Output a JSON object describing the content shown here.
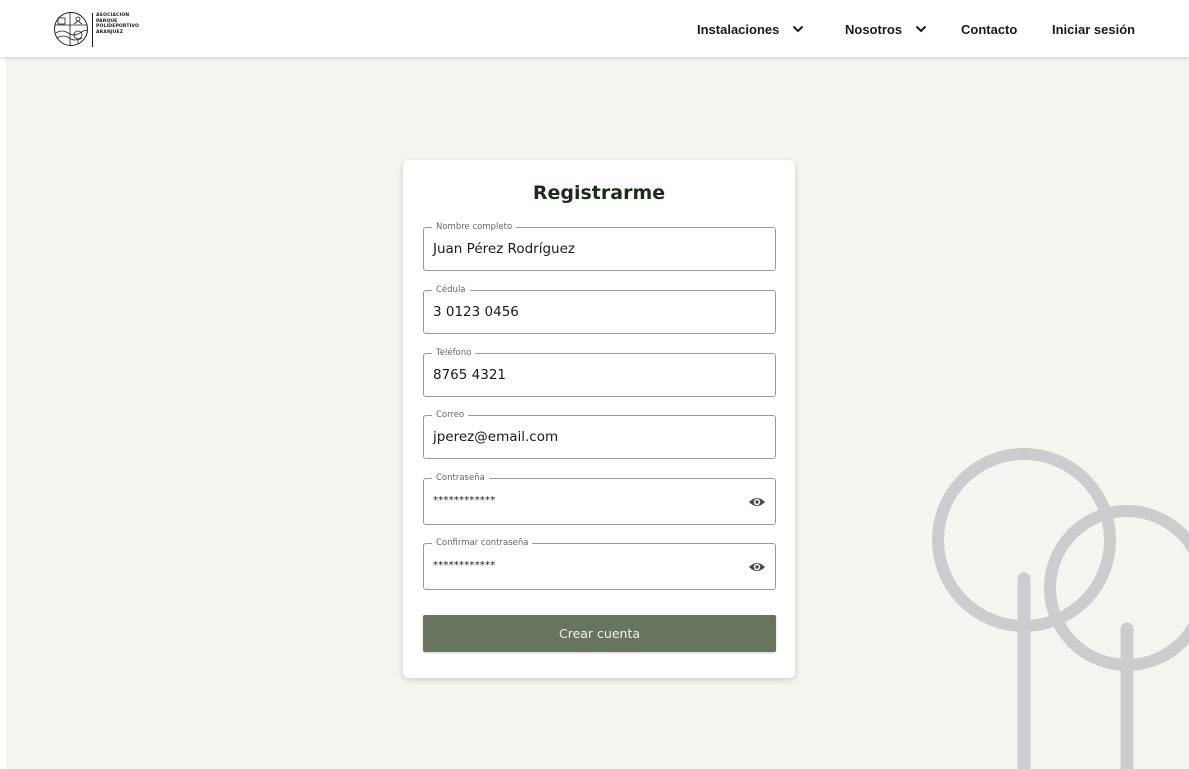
{
  "navbar": {
    "logo": {
      "lines": [
        "ASOCIACION",
        "PARQUE",
        "POLIDEPORTIVO",
        "ARANJUEZ"
      ],
      "icon": "park-emblem-icon"
    },
    "items": [
      {
        "label": "Instalaciones",
        "icon": "chevron-down-icon"
      },
      {
        "label": "Nosotros",
        "icon": "chevron-down-icon"
      },
      {
        "label": "Contacto"
      },
      {
        "label": "Iniciar sesión"
      }
    ]
  },
  "form": {
    "title": "Registrarme",
    "fields": [
      {
        "label": "Nombre completo",
        "value": "Juan Pérez Rodríguez"
      },
      {
        "label": "Cédula",
        "value": "3 0123 0456"
      },
      {
        "label": "Teléfono",
        "value": "8765 4321"
      },
      {
        "label": "Correo",
        "value": "jperez@email.com"
      },
      {
        "label": "Contraseña",
        "value": "************",
        "icon": "eye-icon"
      },
      {
        "label": "Confirmar contraseña",
        "value": "************",
        "icon": "eye-icon"
      }
    ],
    "submit_label": "Crear cuenta"
  },
  "colors": {
    "background": "#f4f5f1",
    "button": "#69745e",
    "decoration": "#cccccc",
    "title": "#1d2b1a"
  }
}
